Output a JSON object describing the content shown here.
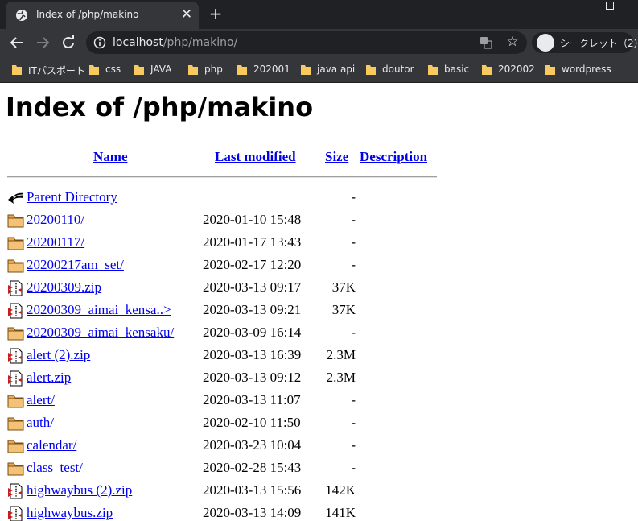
{
  "browser": {
    "tab_title": "Index of /php/makino",
    "url_host": "localhost",
    "url_path": "/php/makino/",
    "incognito_label": "シークレット（2）",
    "bookmarks": [
      "ITパスポート",
      "css",
      "JAVA",
      "php",
      "202001",
      "java api",
      "doutor",
      "basic",
      "202002",
      "wordpress"
    ]
  },
  "page": {
    "title": "Index of /php/makino",
    "columns": {
      "name": "Name",
      "last_modified": "Last modified",
      "size": "Size",
      "description": "Description"
    },
    "rows": [
      {
        "icon": "back-icon",
        "name": "Parent Directory",
        "date": "",
        "size": "-"
      },
      {
        "icon": "folder-icon",
        "name": "20200110/",
        "date": "2020-01-10 15:48",
        "size": "-"
      },
      {
        "icon": "folder-icon",
        "name": "20200117/",
        "date": "2020-01-17 13:43",
        "size": "-"
      },
      {
        "icon": "folder-icon",
        "name": "20200217am_set/",
        "date": "2020-02-17 12:20",
        "size": "-"
      },
      {
        "icon": "zip-icon",
        "name": "20200309.zip",
        "date": "2020-03-13 09:17",
        "size": "37K"
      },
      {
        "icon": "zip-icon",
        "name": "20200309_aimai_kensa..>",
        "date": "2020-03-13 09:21",
        "size": "37K"
      },
      {
        "icon": "folder-icon",
        "name": "20200309_aimai_kensaku/",
        "date": "2020-03-09 16:14",
        "size": "-"
      },
      {
        "icon": "zip-icon",
        "name": "alert (2).zip",
        "date": "2020-03-13 16:39",
        "size": "2.3M"
      },
      {
        "icon": "zip-icon",
        "name": "alert.zip",
        "date": "2020-03-13 09:12",
        "size": "2.3M"
      },
      {
        "icon": "folder-icon",
        "name": "alert/",
        "date": "2020-03-13 11:07",
        "size": "-"
      },
      {
        "icon": "folder-icon",
        "name": "auth/",
        "date": "2020-02-10 11:50",
        "size": "-"
      },
      {
        "icon": "folder-icon",
        "name": "calendar/",
        "date": "2020-03-23 10:04",
        "size": "-"
      },
      {
        "icon": "folder-icon",
        "name": "class_test/",
        "date": "2020-02-28 15:43",
        "size": "-"
      },
      {
        "icon": "zip-icon",
        "name": "highwaybus (2).zip",
        "date": "2020-03-13 15:56",
        "size": "142K"
      },
      {
        "icon": "zip-icon",
        "name": "highwaybus.zip",
        "date": "2020-03-13 14:09",
        "size": "141K"
      }
    ]
  },
  "colors": {
    "link": "#0000ee",
    "chrome_dark": "#202124",
    "chrome_toolbar": "#35363a",
    "folder_yellow": "#f7c95e"
  }
}
